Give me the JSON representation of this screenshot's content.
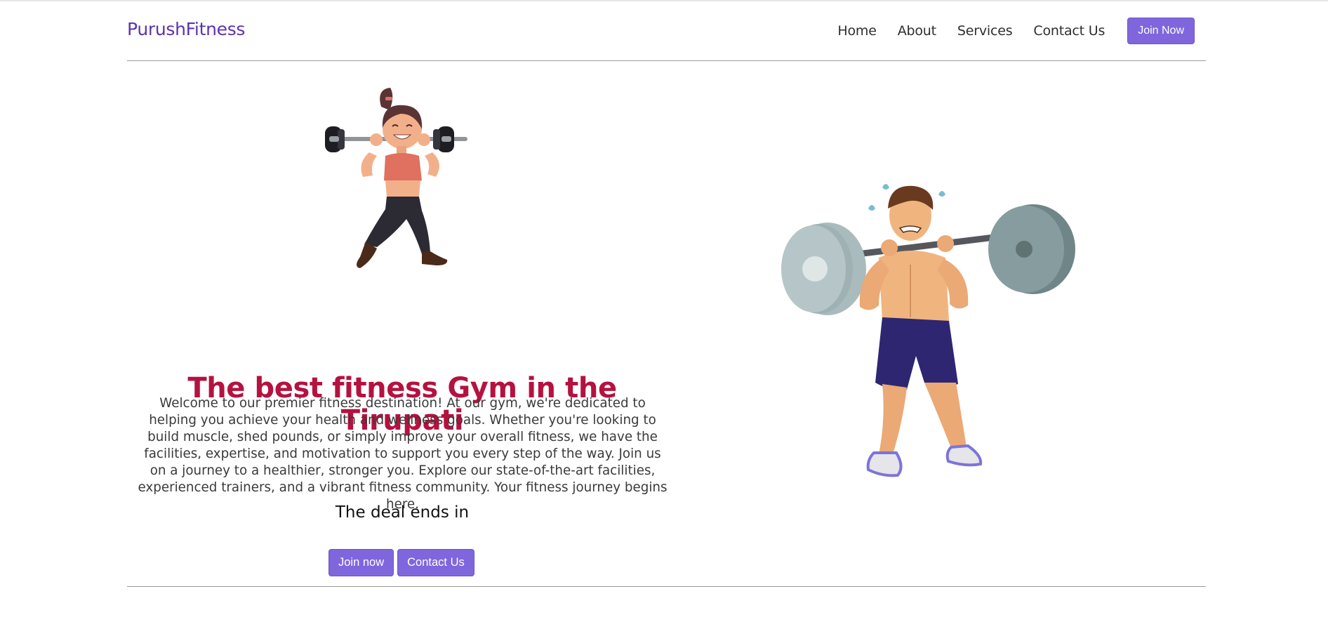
{
  "brand": {
    "name": "PurushFitness",
    "color": "#5b34b0"
  },
  "nav": {
    "links": [
      "Home",
      "About",
      "Services",
      "Contact Us"
    ],
    "cta_label": "Join Now"
  },
  "hero": {
    "title": "The best fitness Gym in the Tirupati",
    "description": "Welcome to our premier fitness destination! At our gym, we're dedicated to helping you achieve your health and wellness goals. Whether you're looking to build muscle, shed pounds, or simply improve your overall fitness, we have the facilities, expertise, and motivation to support you every step of the way. Join us on a journey to a healthier, stronger you. Explore our state-of-the-art facilities, experienced trainers, and a vibrant fitness community. Your fitness journey begins here.",
    "deal_text": "The deal ends in",
    "primary_button": "Join now",
    "secondary_button": "Contact Us",
    "illustrations": {
      "left": "woman-lifting-barbell-illustration",
      "right": "man-lifting-heavy-barbell-illustration"
    }
  },
  "colors": {
    "accent": "#8066dd",
    "title": "#b5123f",
    "divider": "#9a9a9a"
  }
}
